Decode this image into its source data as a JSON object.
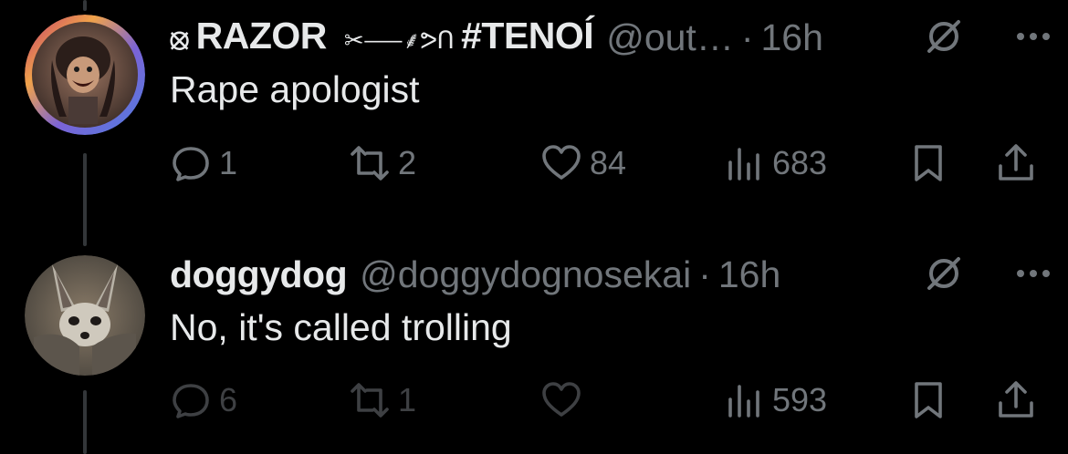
{
  "tweets": [
    {
      "name_prefix": "⦻",
      "name": "RAZOR",
      "name_suffix": "✂⸺⸙ᕗᑎ",
      "name_tag": "#TENOÍ",
      "handle": "@out…",
      "dot": "·",
      "time": "16h",
      "text": "Rape apologist",
      "avatar": "anime-character-avatar",
      "replies": "1",
      "reposts": "2",
      "likes": "84",
      "views": "683"
    },
    {
      "name": "doggydog",
      "handle": "@doggydognosekai",
      "dot": "·",
      "time": "16h",
      "text": "No, it's called trolling",
      "avatar": "bat-eared-fox-avatar",
      "replies": "6",
      "reposts": "1",
      "likes": "",
      "views": "593"
    }
  ],
  "icons": {
    "reply": "reply-icon",
    "repost": "repost-icon",
    "like": "heart-icon",
    "views": "views-icon",
    "bookmark": "bookmark-icon",
    "share": "share-icon",
    "grok": "grok-icon",
    "more": "more-icon"
  },
  "colors": {
    "background": "#000000",
    "text": "#e7e9ea",
    "muted": "#71767b",
    "thread_line": "#333639"
  }
}
